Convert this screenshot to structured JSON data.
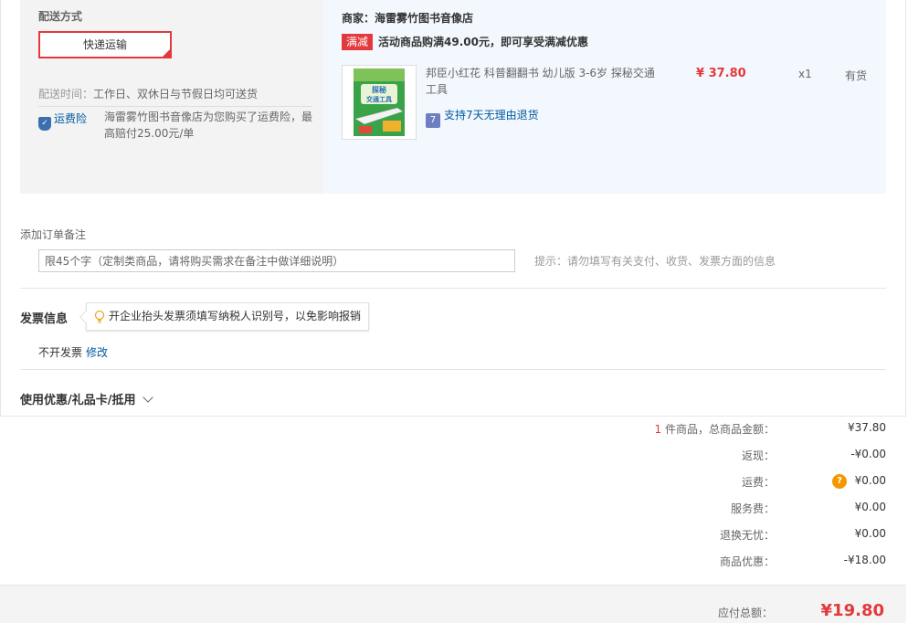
{
  "shipping": {
    "label": "配送方式",
    "option": "快递运输",
    "time_label": "配送时间：",
    "time_value": "工作日、双休日与节假日均可送货",
    "insurance_badge": "运费险",
    "insurance_icon": "shield-icon",
    "insurance_text": "海雷雾竹图书音像店为您购买了运费险，最高赔付25.00元/单"
  },
  "shop": {
    "name": "商家：海雷雾竹图书音像店",
    "promo_tag": "满减",
    "promo_text": "活动商品购满49.00元，即可享受满减优惠"
  },
  "product": {
    "title": "邦臣小红花 科普翻翻书 幼儿版 3-6岁 探秘交通工具",
    "cover_text": "探秘交通工具",
    "return_policy": "支持7天无理由退货",
    "return_icon_char": "7",
    "price": "¥ 37.80",
    "qty": "x1",
    "stock": "有货"
  },
  "remark": {
    "label": "添加订单备注",
    "placeholder": "限45个字（定制类商品，请将购买需求在备注中做详细说明）",
    "hint": "提示：请勿填写有关支付、收货、发票方面的信息"
  },
  "invoice": {
    "title": "发票信息",
    "tip": "开企业抬头发票须填写纳税人识别号，以免影响报销",
    "status": "不开发票",
    "edit": "修改"
  },
  "coupon": {
    "label": "使用优惠/礼品卡/抵用"
  },
  "summary": {
    "items_count": "1",
    "items_label": " 件商品，总商品金额：",
    "items_total": "¥37.80",
    "cashback_label": "返现：",
    "cashback": "-¥0.00",
    "shipping_label": "运费：",
    "shipping": "¥0.00",
    "service_label": "服务费：",
    "service": "¥0.00",
    "return_label": "退换无忧：",
    "return_fee": "¥0.00",
    "discount_label": "商品优惠：",
    "discount": "-¥18.00",
    "payable_label": "应付总额：",
    "payable": "¥19.80"
  },
  "colors": {
    "accent": "#e4393c",
    "link": "#005aa0",
    "help_badge": "#f39800"
  }
}
